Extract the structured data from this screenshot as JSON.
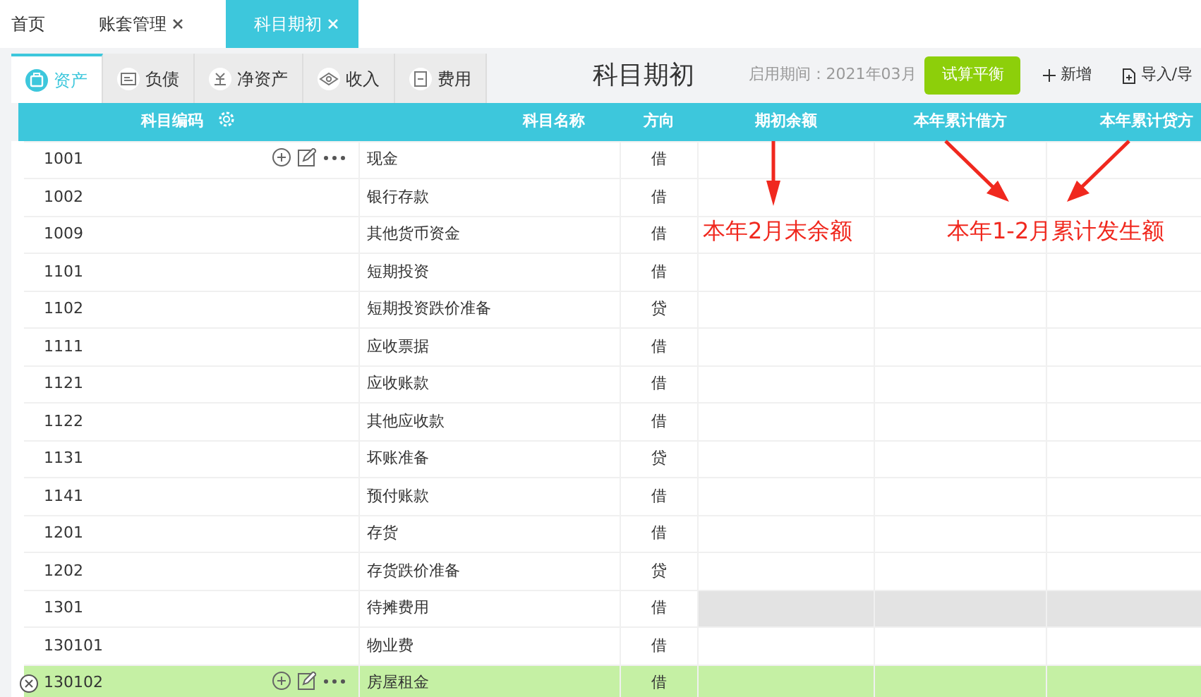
{
  "top_tabs": [
    {
      "label": "首页",
      "closable": false,
      "selected": false
    },
    {
      "label": "账套管理",
      "closable": true,
      "selected": false
    },
    {
      "label": "科目期初",
      "closable": true,
      "selected": true
    }
  ],
  "category_tabs": [
    {
      "label": "资产",
      "kind": "asset",
      "selected": true
    },
    {
      "label": "负债",
      "kind": "liability",
      "selected": false
    },
    {
      "label": "净资产",
      "kind": "equity",
      "selected": false
    },
    {
      "label": "收入",
      "kind": "income",
      "selected": false
    },
    {
      "label": "费用",
      "kind": "expense",
      "selected": false
    }
  ],
  "title": "科目期初",
  "period": "启用期间：2021年03月",
  "toolbar": [
    {
      "label": "试算平衡",
      "kind": "primary"
    },
    {
      "label": "新增",
      "kind": "add"
    },
    {
      "label": "导入/导",
      "kind": "import"
    }
  ],
  "table": {
    "columns": [
      "科目编码",
      "科目名称",
      "方向",
      "期初余额",
      "本年累计借方",
      "本年累计贷方"
    ],
    "rows": [
      {
        "code": "1001",
        "name": "现金",
        "direction": "借",
        "show_actions": true,
        "selected": false,
        "disabled": false
      },
      {
        "code": "1002",
        "name": "银行存款",
        "direction": "借",
        "show_actions": false,
        "selected": false,
        "disabled": false
      },
      {
        "code": "1009",
        "name": "其他货币资金",
        "direction": "借",
        "show_actions": false,
        "selected": false,
        "disabled": false
      },
      {
        "code": "1101",
        "name": "短期投资",
        "direction": "借",
        "show_actions": false,
        "selected": false,
        "disabled": false
      },
      {
        "code": "1102",
        "name": "短期投资跌价准备",
        "direction": "贷",
        "show_actions": false,
        "selected": false,
        "disabled": false
      },
      {
        "code": "1111",
        "name": "应收票据",
        "direction": "借",
        "show_actions": false,
        "selected": false,
        "disabled": false
      },
      {
        "code": "1121",
        "name": "应收账款",
        "direction": "借",
        "show_actions": false,
        "selected": false,
        "disabled": false
      },
      {
        "code": "1122",
        "name": "其他应收款",
        "direction": "借",
        "show_actions": false,
        "selected": false,
        "disabled": false
      },
      {
        "code": "1131",
        "name": "坏账准备",
        "direction": "贷",
        "show_actions": false,
        "selected": false,
        "disabled": false
      },
      {
        "code": "1141",
        "name": "预付账款",
        "direction": "借",
        "show_actions": false,
        "selected": false,
        "disabled": false
      },
      {
        "code": "1201",
        "name": "存货",
        "direction": "借",
        "show_actions": false,
        "selected": false,
        "disabled": false
      },
      {
        "code": "1202",
        "name": "存货跌价准备",
        "direction": "贷",
        "show_actions": false,
        "selected": false,
        "disabled": false
      },
      {
        "code": "1301",
        "name": "待摊费用",
        "direction": "借",
        "show_actions": false,
        "selected": false,
        "disabled": true
      },
      {
        "code": "130101",
        "name": "物业费",
        "direction": "借",
        "show_actions": false,
        "selected": false,
        "disabled": false
      },
      {
        "code": "130102",
        "name": "房屋租金",
        "direction": "借",
        "show_actions": true,
        "selected": true,
        "disabled": false
      }
    ]
  },
  "annotations": [
    {
      "text": "本年2月末余额",
      "kind": "opening"
    },
    {
      "text": "本年1-2月累计发生额",
      "kind": "cumulative"
    }
  ]
}
